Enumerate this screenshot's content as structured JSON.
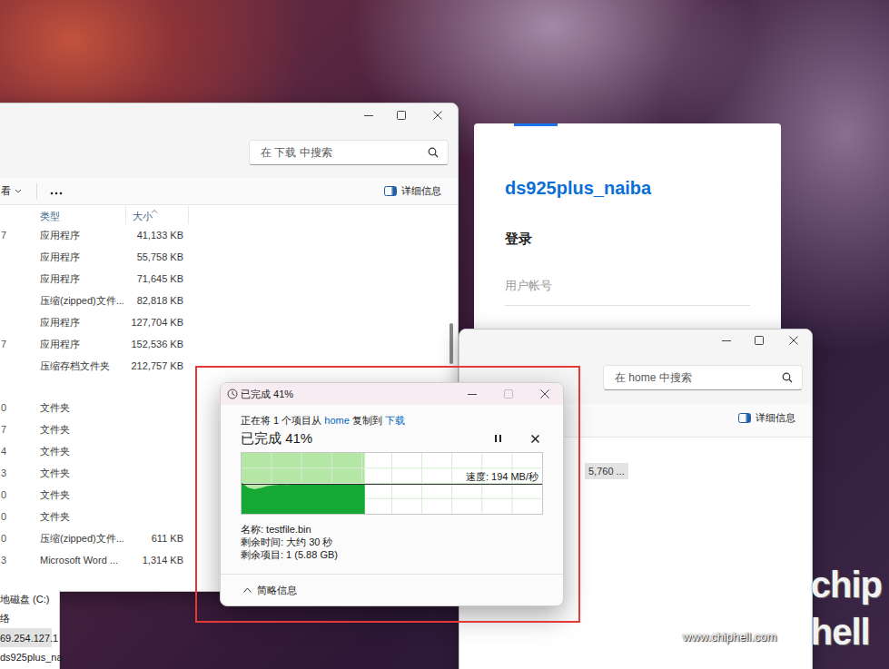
{
  "downloads_window": {
    "search": {
      "placeholder": "在 下载 中搜索"
    },
    "toolbar": {
      "view": "看",
      "details": "详细信息"
    },
    "columns": [
      {
        "label": "类型",
        "sorted": false
      },
      {
        "label": "大小",
        "sorted": true
      }
    ],
    "groups": [
      {
        "rows": [
          {
            "date": "7",
            "type": "应用程序",
            "size": "41,133 KB"
          },
          {
            "type": "应用程序",
            "size": "55,758 KB"
          },
          {
            "type": "应用程序",
            "size": "71,645 KB"
          },
          {
            "type": "压缩(zipped)文件...",
            "size": "82,818 KB"
          },
          {
            "type": "应用程序",
            "size": "127,704 KB"
          },
          {
            "date": "7",
            "type": "应用程序",
            "size": "152,536 KB"
          },
          {
            "type": "压缩存档文件夹",
            "size": "212,757 KB"
          }
        ]
      },
      {
        "rows": [
          {
            "date": "0",
            "type": "文件夹"
          },
          {
            "date": "7",
            "type": "文件夹"
          },
          {
            "date": "4",
            "type": "文件夹"
          },
          {
            "date": "3",
            "type": "文件夹"
          },
          {
            "date": "0",
            "type": "文件夹"
          },
          {
            "date": "0",
            "type": "文件夹"
          },
          {
            "date": "0",
            "type": "压缩(zipped)文件...",
            "size": "611 KB"
          },
          {
            "date": "3",
            "type": "Microsoft Word ...",
            "size": "1,314 KB"
          }
        ]
      }
    ]
  },
  "nav_pane": {
    "items": [
      {
        "label": "地磁盘 (C:)",
        "selected": false
      },
      {
        "label": "络",
        "selected": false
      },
      {
        "label": "69.254.127.1",
        "selected": true
      },
      {
        "label": "ds925plus_na",
        "selected": false
      }
    ]
  },
  "login_card": {
    "title": "ds925plus_naiba",
    "heading": "登录",
    "username": {
      "placeholder": "用户帐号"
    }
  },
  "home_window": {
    "search": {
      "placeholder": "在 home 中搜索"
    },
    "details": "详细信息",
    "items": [
      {
        "label": "5,760 ...",
        "selected": true
      }
    ]
  },
  "copy_dialog": {
    "title": "已完成 41%",
    "description": [
      {
        "text": "正在将 1 个项目从 ",
        "kind": "text"
      },
      {
        "text": "home",
        "kind": "link"
      },
      {
        "text": " 复制到 ",
        "kind": "text"
      },
      {
        "text": "下载",
        "kind": "link"
      }
    ],
    "heading": "已完成 41%",
    "paused": false,
    "progress": {
      "level": 0.41,
      "speed_series": [
        205,
        172,
        162,
        170,
        182,
        188,
        191,
        189,
        192,
        195,
        193,
        194,
        196,
        194,
        193,
        195,
        194,
        195,
        194,
        194
      ],
      "speed": "速度: 194 MB/秒"
    },
    "details": [
      "名称: testfile.bin",
      "剩余时间: 大约 30 秒",
      "剩余项目: 1 (5.88 GB)"
    ],
    "footer": "简略信息"
  },
  "watermark": {
    "logo": [
      "chip",
      "hell"
    ],
    "url": "www.chiphell.com"
  }
}
